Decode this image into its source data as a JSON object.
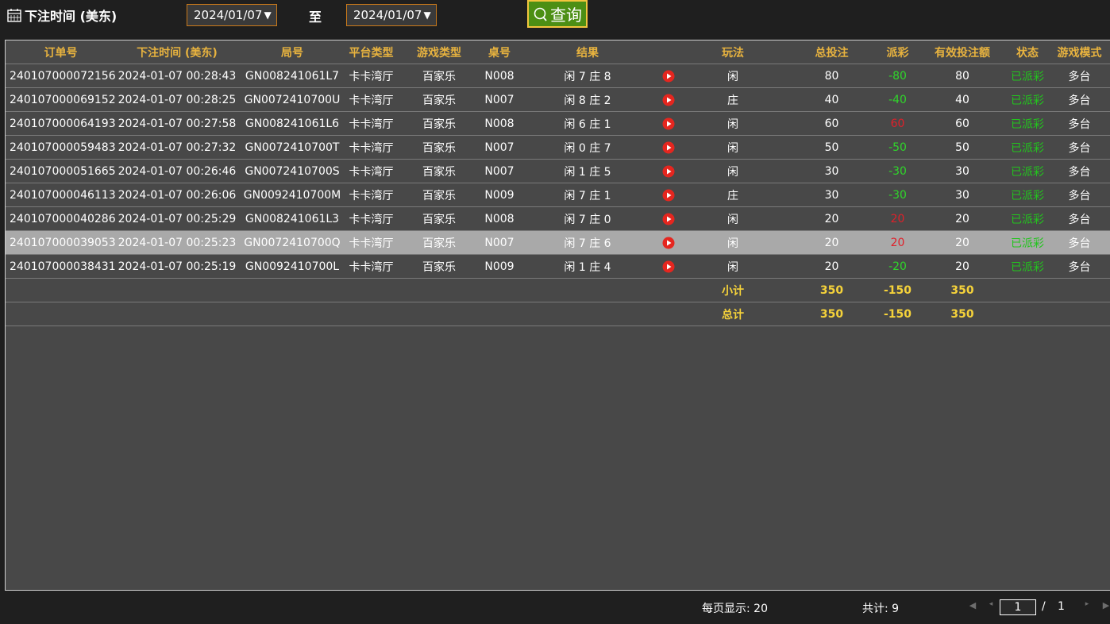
{
  "header": {
    "title": "下注时间 (美东)",
    "start_date": "2024/01/07",
    "to_label": "至",
    "end_date": "2024/01/07",
    "query_label": "查询"
  },
  "columns": [
    "订单号",
    "下注时间 (美东)",
    "局号",
    "平台类型",
    "游戏类型",
    "桌号",
    "结果",
    "",
    "玩法",
    "总投注",
    "派彩",
    "有效投注额",
    "状态",
    "游戏模式"
  ],
  "rows": [
    {
      "order": "240107000072156",
      "time": "2024-01-07 00:28:43",
      "round": "GN008241061L7",
      "platform": "卡卡湾厅",
      "game": "百家乐",
      "table": "N008",
      "result": "闲 7 庄 8",
      "play": "闲",
      "total": "80",
      "payout": "-80",
      "payout_color": "green",
      "valid": "80",
      "status": "已派彩",
      "mode": "多台"
    },
    {
      "order": "240107000069152",
      "time": "2024-01-07 00:28:25",
      "round": "GN0072410700U",
      "platform": "卡卡湾厅",
      "game": "百家乐",
      "table": "N007",
      "result": "闲 8 庄 2",
      "play": "庄",
      "total": "40",
      "payout": "-40",
      "payout_color": "green",
      "valid": "40",
      "status": "已派彩",
      "mode": "多台"
    },
    {
      "order": "240107000064193",
      "time": "2024-01-07 00:27:58",
      "round": "GN008241061L6",
      "platform": "卡卡湾厅",
      "game": "百家乐",
      "table": "N008",
      "result": "闲 6 庄 1",
      "play": "闲",
      "total": "60",
      "payout": "60",
      "payout_color": "red",
      "valid": "60",
      "status": "已派彩",
      "mode": "多台"
    },
    {
      "order": "240107000059483",
      "time": "2024-01-07 00:27:32",
      "round": "GN0072410700T",
      "platform": "卡卡湾厅",
      "game": "百家乐",
      "table": "N007",
      "result": "闲 0 庄 7",
      "play": "闲",
      "total": "50",
      "payout": "-50",
      "payout_color": "green",
      "valid": "50",
      "status": "已派彩",
      "mode": "多台"
    },
    {
      "order": "240107000051665",
      "time": "2024-01-07 00:26:46",
      "round": "GN0072410700S",
      "platform": "卡卡湾厅",
      "game": "百家乐",
      "table": "N007",
      "result": "闲 1 庄 5",
      "play": "闲",
      "total": "30",
      "payout": "-30",
      "payout_color": "green",
      "valid": "30",
      "status": "已派彩",
      "mode": "多台"
    },
    {
      "order": "240107000046113",
      "time": "2024-01-07 00:26:06",
      "round": "GN0092410700M",
      "platform": "卡卡湾厅",
      "game": "百家乐",
      "table": "N009",
      "result": "闲 7 庄 1",
      "play": "庄",
      "total": "30",
      "payout": "-30",
      "payout_color": "green",
      "valid": "30",
      "status": "已派彩",
      "mode": "多台"
    },
    {
      "order": "240107000040286",
      "time": "2024-01-07 00:25:29",
      "round": "GN008241061L3",
      "platform": "卡卡湾厅",
      "game": "百家乐",
      "table": "N008",
      "result": "闲 7 庄 0",
      "play": "闲",
      "total": "20",
      "payout": "20",
      "payout_color": "red",
      "valid": "20",
      "status": "已派彩",
      "mode": "多台"
    },
    {
      "order": "240107000039053",
      "time": "2024-01-07 00:25:23",
      "round": "GN0072410700Q",
      "platform": "卡卡湾厅",
      "game": "百家乐",
      "table": "N007",
      "result": "闲 7 庄 6",
      "play": "闲",
      "total": "20",
      "payout": "20",
      "payout_color": "red",
      "valid": "20",
      "status": "已派彩",
      "mode": "多台",
      "highlight": true
    },
    {
      "order": "240107000038431",
      "time": "2024-01-07 00:25:19",
      "round": "GN0092410700L",
      "platform": "卡卡湾厅",
      "game": "百家乐",
      "table": "N009",
      "result": "闲 1 庄 4",
      "play": "闲",
      "total": "20",
      "payout": "-20",
      "payout_color": "green",
      "valid": "20",
      "status": "已派彩",
      "mode": "多台"
    }
  ],
  "subtotal": {
    "label": "小计",
    "total": "350",
    "payout": "-150",
    "valid": "350"
  },
  "grandtotal": {
    "label": "总计",
    "total": "350",
    "payout": "-150",
    "valid": "350"
  },
  "footer": {
    "page_size": "每页显示: 20",
    "total_count": "共计: 9",
    "current_page": "1",
    "page_sep": "/",
    "total_pages": "1"
  },
  "colors": {
    "header_text": "#e8b33f",
    "positive_payout": "#2fd62a",
    "negative_payout": "#e0202a",
    "status": "#22c51d",
    "query_button": "#4c8f14",
    "highlight_row": "#a9a9a9"
  },
  "icons": {
    "calendar": "calendar-icon",
    "search": "search-icon",
    "replay": "play-video-icon"
  }
}
